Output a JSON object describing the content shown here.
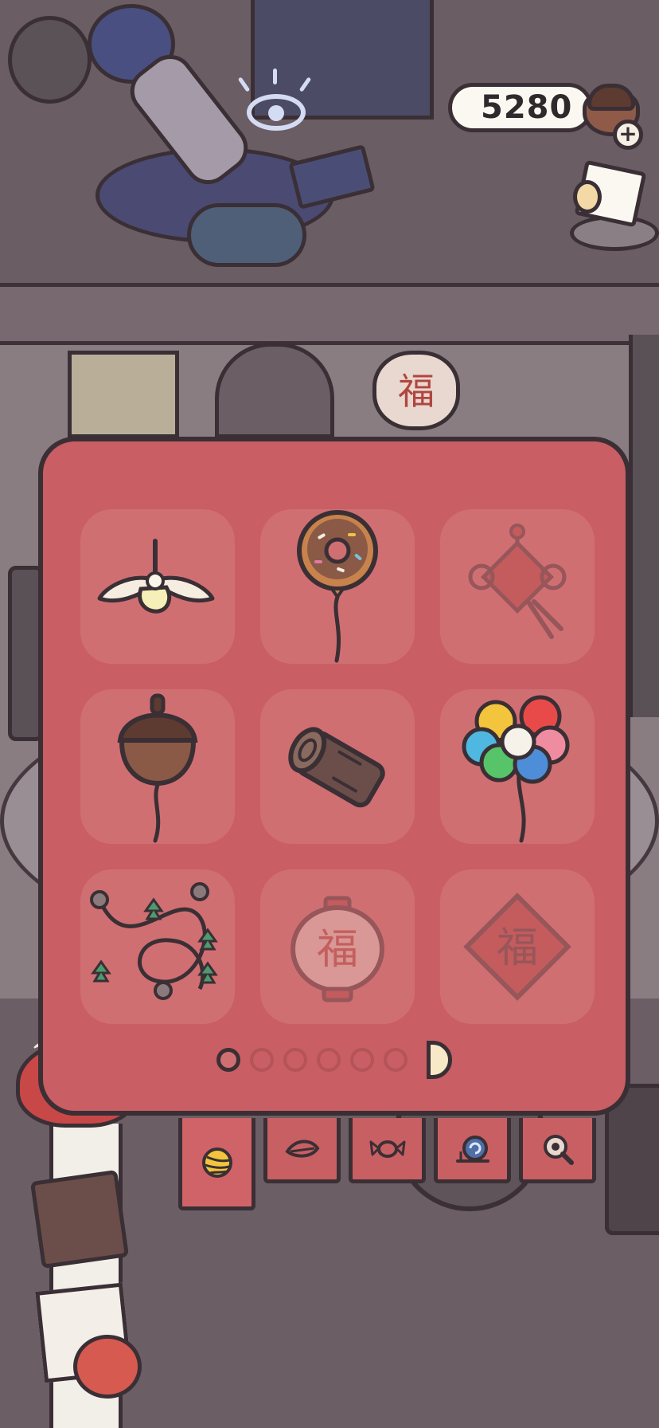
{
  "hud": {
    "currency": "5280",
    "currency_icon": "acorn-icon",
    "add_icon": "plus-icon",
    "journal_icon": "journal-icon",
    "look_icon": "eye-icon"
  },
  "room": {
    "lantern_label": "福"
  },
  "decor_panel": {
    "items": [
      {
        "icon": "ceiling-fan-lamp",
        "owned": true
      },
      {
        "icon": "donut-balloon",
        "owned": true
      },
      {
        "icon": "chinese-knot",
        "owned": false
      },
      {
        "icon": "acorn-balloon",
        "owned": true
      },
      {
        "icon": "log-stool",
        "owned": true
      },
      {
        "icon": "rainbow-balloon-bunch",
        "owned": true
      },
      {
        "icon": "acorn-garland",
        "owned": true
      },
      {
        "icon": "fu-lantern",
        "owned": false,
        "label": "福"
      },
      {
        "icon": "fu-diamond-sign",
        "owned": false,
        "label": "福"
      }
    ],
    "page_count": 6,
    "current_page": 1
  },
  "tabs": [
    {
      "icon": "yarn-ball-icon",
      "active": true
    },
    {
      "icon": "leaf-icon",
      "active": false
    },
    {
      "icon": "candy-icon",
      "active": false
    },
    {
      "icon": "snail-icon",
      "active": false
    },
    {
      "icon": "magnifier-icon",
      "active": false
    }
  ],
  "colors": {
    "panel": "#c95e64",
    "slot": "#d06f72",
    "outline": "#3a2f35",
    "arrow": "#f7e8c7"
  }
}
